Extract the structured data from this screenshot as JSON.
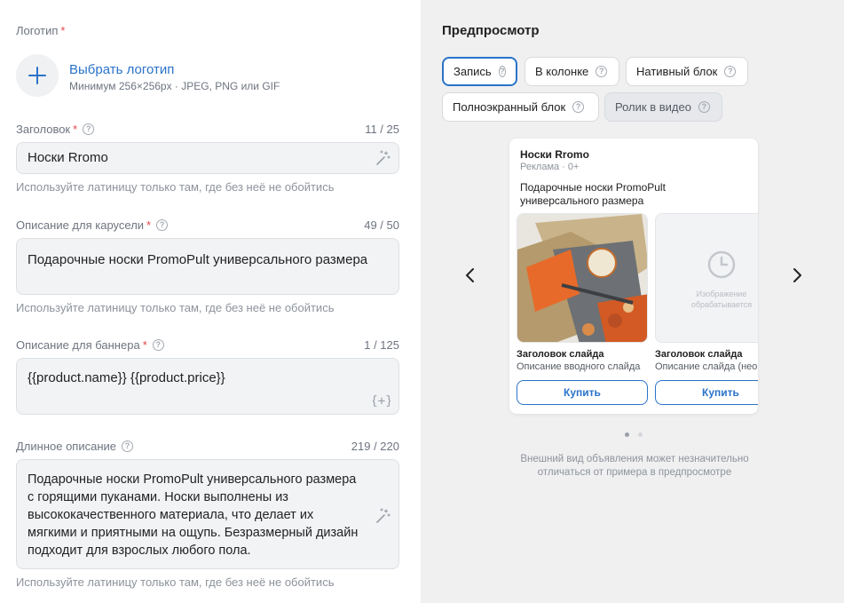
{
  "form": {
    "logo": {
      "label": "Логотип",
      "required_mark": "*",
      "select_label": "Выбрать логотип",
      "requirements": "Минимум 256×256px · JPEG, PNG или GIF"
    },
    "headline": {
      "label": "Заголовок",
      "required_mark": "*",
      "counter": "11 / 25",
      "value": "Носки Rromo",
      "hint": "Используйте латиницу только там, где без неё не обойтись"
    },
    "carousel_description": {
      "label": "Описание для карусели",
      "required_mark": "*",
      "counter": "49 / 50",
      "value": "Подарочные носки PromoPult универсального размера",
      "hint": "Используйте латиницу только там, где без неё не обойтись"
    },
    "banner_description": {
      "label": "Описание для баннера",
      "required_mark": "*",
      "counter": "1 / 125",
      "value": "{{product.name}} {{product.price}}"
    },
    "long_description": {
      "label": "Длинное описание",
      "counter": "219 / 220",
      "lines": [
        "Подарочные носки PromoPult универсального размера",
        "с горящими пуканами. Носки выполнены из",
        "высококачественного материала, что делает их",
        "мягкими и приятными на ощупь. Безразмерный дизайн",
        "подходит для взрослых любого пола."
      ],
      "hint": "Используйте латиницу только там, где без неё не обойтись"
    }
  },
  "preview": {
    "title": "Предпросмотр",
    "tabs": [
      {
        "label": "Запись",
        "active": true
      },
      {
        "label": "В колонке"
      },
      {
        "label": "Нативный блок"
      },
      {
        "label": "Полноэкранный блок"
      },
      {
        "label": "Ролик в видео",
        "disabled": true
      }
    ],
    "card": {
      "brand": "Носки Rromo",
      "meta": "Реклама · 0+",
      "text": "Подарочные носки PromoPult универсального размера",
      "slides": [
        {
          "title": "Заголовок слайда",
          "description": "Описание вводного слайда",
          "button": "Купить"
        },
        {
          "title": "Заголовок слайда",
          "description": "Описание слайда (необ",
          "button": "Купить",
          "processing": "Изображение обрабатывается"
        }
      ]
    },
    "note": "Внешний вид объявления может незначительно отличаться от примера в предпросмотре"
  },
  "colors": {
    "accent": "#2a73c9",
    "required": "#e64646",
    "preview_bg": "#f0f0f1"
  },
  "icons": [
    "plus-icon",
    "help-icon",
    "magic-wand-icon",
    "variable-insert-icon",
    "chevron-left-icon",
    "chevron-right-icon",
    "clock-icon"
  ]
}
